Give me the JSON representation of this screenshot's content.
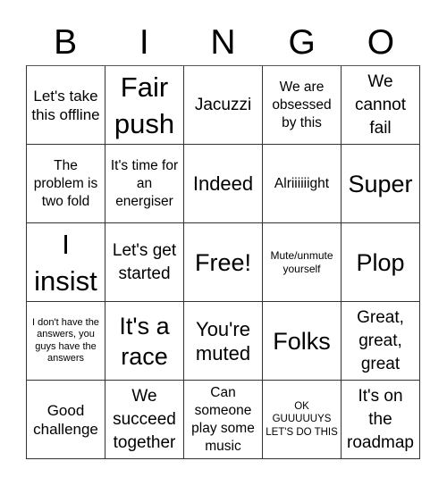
{
  "header": {
    "letters": [
      "B",
      "I",
      "N",
      "G",
      "O"
    ]
  },
  "board": {
    "rows": [
      [
        "Let's take this offline",
        "Fair push",
        "Jacuzzi",
        "We are obsessed by this",
        "We cannot fail"
      ],
      [
        "The problem is two fold",
        "It's time for an energiser",
        "Indeed",
        "Alriiiiiight",
        "Super"
      ],
      [
        "I insist",
        "Let's get started",
        "Free!",
        "Mute/unmute yourself",
        "Plop"
      ],
      [
        "I don't have the answers, you guys have the answers",
        "It's a race",
        "You're muted",
        "Folks",
        "Great, great, great"
      ],
      [
        "Good challenge",
        "We succeed together",
        "Can someone play some music",
        "OK GUUUUUYS LET'S DO THIS",
        "It's on the roadmap"
      ]
    ]
  }
}
